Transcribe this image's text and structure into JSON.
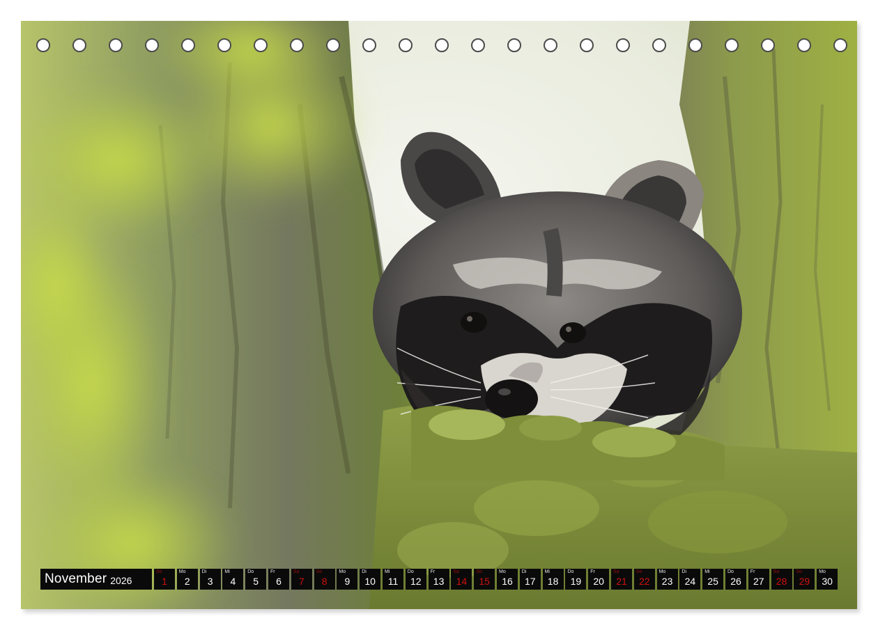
{
  "calendar": {
    "month": "November",
    "year": "2026",
    "days": [
      {
        "wd": "So",
        "num": "1",
        "weekend": true
      },
      {
        "wd": "Mo",
        "num": "2",
        "weekend": false
      },
      {
        "wd": "Di",
        "num": "3",
        "weekend": false
      },
      {
        "wd": "Mi",
        "num": "4",
        "weekend": false
      },
      {
        "wd": "Do",
        "num": "5",
        "weekend": false
      },
      {
        "wd": "Fr",
        "num": "6",
        "weekend": false
      },
      {
        "wd": "Sa",
        "num": "7",
        "weekend": true
      },
      {
        "wd": "So",
        "num": "8",
        "weekend": true
      },
      {
        "wd": "Mo",
        "num": "9",
        "weekend": false
      },
      {
        "wd": "Di",
        "num": "10",
        "weekend": false
      },
      {
        "wd": "Mi",
        "num": "11",
        "weekend": false
      },
      {
        "wd": "Do",
        "num": "12",
        "weekend": false
      },
      {
        "wd": "Fr",
        "num": "13",
        "weekend": false
      },
      {
        "wd": "Sa",
        "num": "14",
        "weekend": true
      },
      {
        "wd": "So",
        "num": "15",
        "weekend": true
      },
      {
        "wd": "Mo",
        "num": "16",
        "weekend": false
      },
      {
        "wd": "Di",
        "num": "17",
        "weekend": false
      },
      {
        "wd": "Mi",
        "num": "18",
        "weekend": false
      },
      {
        "wd": "Do",
        "num": "19",
        "weekend": false
      },
      {
        "wd": "Fr",
        "num": "20",
        "weekend": false
      },
      {
        "wd": "Sa",
        "num": "21",
        "weekend": true
      },
      {
        "wd": "So",
        "num": "22",
        "weekend": true
      },
      {
        "wd": "Mo",
        "num": "23",
        "weekend": false
      },
      {
        "wd": "Di",
        "num": "24",
        "weekend": false
      },
      {
        "wd": "Mi",
        "num": "25",
        "weekend": false
      },
      {
        "wd": "Do",
        "num": "26",
        "weekend": false
      },
      {
        "wd": "Fr",
        "num": "27",
        "weekend": false
      },
      {
        "wd": "Sa",
        "num": "28",
        "weekend": true
      },
      {
        "wd": "So",
        "num": "29",
        "weekend": true
      },
      {
        "wd": "Mo",
        "num": "30",
        "weekend": false
      }
    ]
  },
  "colors": {
    "weekend_number": "#d11010",
    "calendar_bar": "#0a0a0a",
    "moss": "#8fa34a",
    "bark": "#6f6a58",
    "sky": "#eef0e6"
  }
}
